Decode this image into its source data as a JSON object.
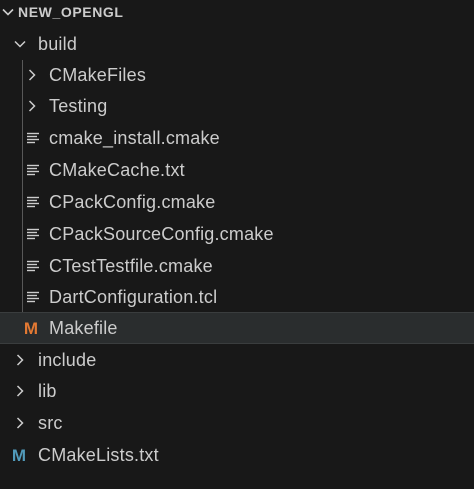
{
  "explorer": {
    "section_title": "NEW_OPENGL",
    "build_folder": "build",
    "build_children": [
      {
        "label": "CMakeFiles",
        "kind": "folder",
        "icon": "chevron-right-icon"
      },
      {
        "label": "Testing",
        "kind": "folder",
        "icon": "chevron-right-icon"
      },
      {
        "label": "cmake_install.cmake",
        "kind": "file",
        "icon": "text-file-icon"
      },
      {
        "label": "CMakeCache.txt",
        "kind": "file",
        "icon": "text-file-icon"
      },
      {
        "label": "CPackConfig.cmake",
        "kind": "file",
        "icon": "text-file-icon"
      },
      {
        "label": "CPackSourceConfig.cmake",
        "kind": "file",
        "icon": "text-file-icon"
      },
      {
        "label": "CTestTestfile.cmake",
        "kind": "file",
        "icon": "text-file-icon"
      },
      {
        "label": "DartConfiguration.tcl",
        "kind": "file",
        "icon": "text-file-icon"
      },
      {
        "label": "Makefile",
        "kind": "file",
        "icon": "makefile-icon",
        "selected": true
      }
    ],
    "root_items": [
      {
        "label": "include",
        "kind": "folder",
        "icon": "chevron-right-icon"
      },
      {
        "label": "lib",
        "kind": "folder",
        "icon": "chevron-right-icon"
      },
      {
        "label": "src",
        "kind": "folder",
        "icon": "chevron-right-icon"
      },
      {
        "label": "CMakeLists.txt",
        "kind": "file",
        "icon": "cmake-m-icon"
      }
    ],
    "icon_letter": "M",
    "colors": {
      "background": "#181818",
      "text": "#cccccc",
      "selected_row": "#2a2d2e",
      "makefile_icon": "#e37933",
      "cmake_icon": "#519aba"
    }
  }
}
